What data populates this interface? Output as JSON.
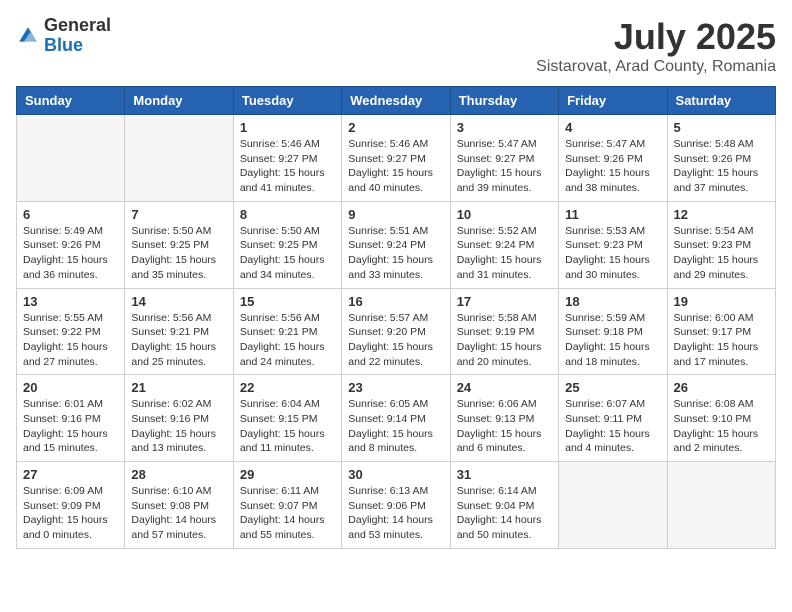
{
  "header": {
    "logo_general": "General",
    "logo_blue": "Blue",
    "title": "July 2025",
    "location": "Sistarovat, Arad County, Romania"
  },
  "days_of_week": [
    "Sunday",
    "Monday",
    "Tuesday",
    "Wednesday",
    "Thursday",
    "Friday",
    "Saturday"
  ],
  "weeks": [
    [
      {
        "day": "",
        "detail": ""
      },
      {
        "day": "",
        "detail": ""
      },
      {
        "day": "1",
        "detail": "Sunrise: 5:46 AM\nSunset: 9:27 PM\nDaylight: 15 hours\nand 41 minutes."
      },
      {
        "day": "2",
        "detail": "Sunrise: 5:46 AM\nSunset: 9:27 PM\nDaylight: 15 hours\nand 40 minutes."
      },
      {
        "day": "3",
        "detail": "Sunrise: 5:47 AM\nSunset: 9:27 PM\nDaylight: 15 hours\nand 39 minutes."
      },
      {
        "day": "4",
        "detail": "Sunrise: 5:47 AM\nSunset: 9:26 PM\nDaylight: 15 hours\nand 38 minutes."
      },
      {
        "day": "5",
        "detail": "Sunrise: 5:48 AM\nSunset: 9:26 PM\nDaylight: 15 hours\nand 37 minutes."
      }
    ],
    [
      {
        "day": "6",
        "detail": "Sunrise: 5:49 AM\nSunset: 9:26 PM\nDaylight: 15 hours\nand 36 minutes."
      },
      {
        "day": "7",
        "detail": "Sunrise: 5:50 AM\nSunset: 9:25 PM\nDaylight: 15 hours\nand 35 minutes."
      },
      {
        "day": "8",
        "detail": "Sunrise: 5:50 AM\nSunset: 9:25 PM\nDaylight: 15 hours\nand 34 minutes."
      },
      {
        "day": "9",
        "detail": "Sunrise: 5:51 AM\nSunset: 9:24 PM\nDaylight: 15 hours\nand 33 minutes."
      },
      {
        "day": "10",
        "detail": "Sunrise: 5:52 AM\nSunset: 9:24 PM\nDaylight: 15 hours\nand 31 minutes."
      },
      {
        "day": "11",
        "detail": "Sunrise: 5:53 AM\nSunset: 9:23 PM\nDaylight: 15 hours\nand 30 minutes."
      },
      {
        "day": "12",
        "detail": "Sunrise: 5:54 AM\nSunset: 9:23 PM\nDaylight: 15 hours\nand 29 minutes."
      }
    ],
    [
      {
        "day": "13",
        "detail": "Sunrise: 5:55 AM\nSunset: 9:22 PM\nDaylight: 15 hours\nand 27 minutes."
      },
      {
        "day": "14",
        "detail": "Sunrise: 5:56 AM\nSunset: 9:21 PM\nDaylight: 15 hours\nand 25 minutes."
      },
      {
        "day": "15",
        "detail": "Sunrise: 5:56 AM\nSunset: 9:21 PM\nDaylight: 15 hours\nand 24 minutes."
      },
      {
        "day": "16",
        "detail": "Sunrise: 5:57 AM\nSunset: 9:20 PM\nDaylight: 15 hours\nand 22 minutes."
      },
      {
        "day": "17",
        "detail": "Sunrise: 5:58 AM\nSunset: 9:19 PM\nDaylight: 15 hours\nand 20 minutes."
      },
      {
        "day": "18",
        "detail": "Sunrise: 5:59 AM\nSunset: 9:18 PM\nDaylight: 15 hours\nand 18 minutes."
      },
      {
        "day": "19",
        "detail": "Sunrise: 6:00 AM\nSunset: 9:17 PM\nDaylight: 15 hours\nand 17 minutes."
      }
    ],
    [
      {
        "day": "20",
        "detail": "Sunrise: 6:01 AM\nSunset: 9:16 PM\nDaylight: 15 hours\nand 15 minutes."
      },
      {
        "day": "21",
        "detail": "Sunrise: 6:02 AM\nSunset: 9:16 PM\nDaylight: 15 hours\nand 13 minutes."
      },
      {
        "day": "22",
        "detail": "Sunrise: 6:04 AM\nSunset: 9:15 PM\nDaylight: 15 hours\nand 11 minutes."
      },
      {
        "day": "23",
        "detail": "Sunrise: 6:05 AM\nSunset: 9:14 PM\nDaylight: 15 hours\nand 8 minutes."
      },
      {
        "day": "24",
        "detail": "Sunrise: 6:06 AM\nSunset: 9:13 PM\nDaylight: 15 hours\nand 6 minutes."
      },
      {
        "day": "25",
        "detail": "Sunrise: 6:07 AM\nSunset: 9:11 PM\nDaylight: 15 hours\nand 4 minutes."
      },
      {
        "day": "26",
        "detail": "Sunrise: 6:08 AM\nSunset: 9:10 PM\nDaylight: 15 hours\nand 2 minutes."
      }
    ],
    [
      {
        "day": "27",
        "detail": "Sunrise: 6:09 AM\nSunset: 9:09 PM\nDaylight: 15 hours\nand 0 minutes."
      },
      {
        "day": "28",
        "detail": "Sunrise: 6:10 AM\nSunset: 9:08 PM\nDaylight: 14 hours\nand 57 minutes."
      },
      {
        "day": "29",
        "detail": "Sunrise: 6:11 AM\nSunset: 9:07 PM\nDaylight: 14 hours\nand 55 minutes."
      },
      {
        "day": "30",
        "detail": "Sunrise: 6:13 AM\nSunset: 9:06 PM\nDaylight: 14 hours\nand 53 minutes."
      },
      {
        "day": "31",
        "detail": "Sunrise: 6:14 AM\nSunset: 9:04 PM\nDaylight: 14 hours\nand 50 minutes."
      },
      {
        "day": "",
        "detail": ""
      },
      {
        "day": "",
        "detail": ""
      }
    ]
  ]
}
